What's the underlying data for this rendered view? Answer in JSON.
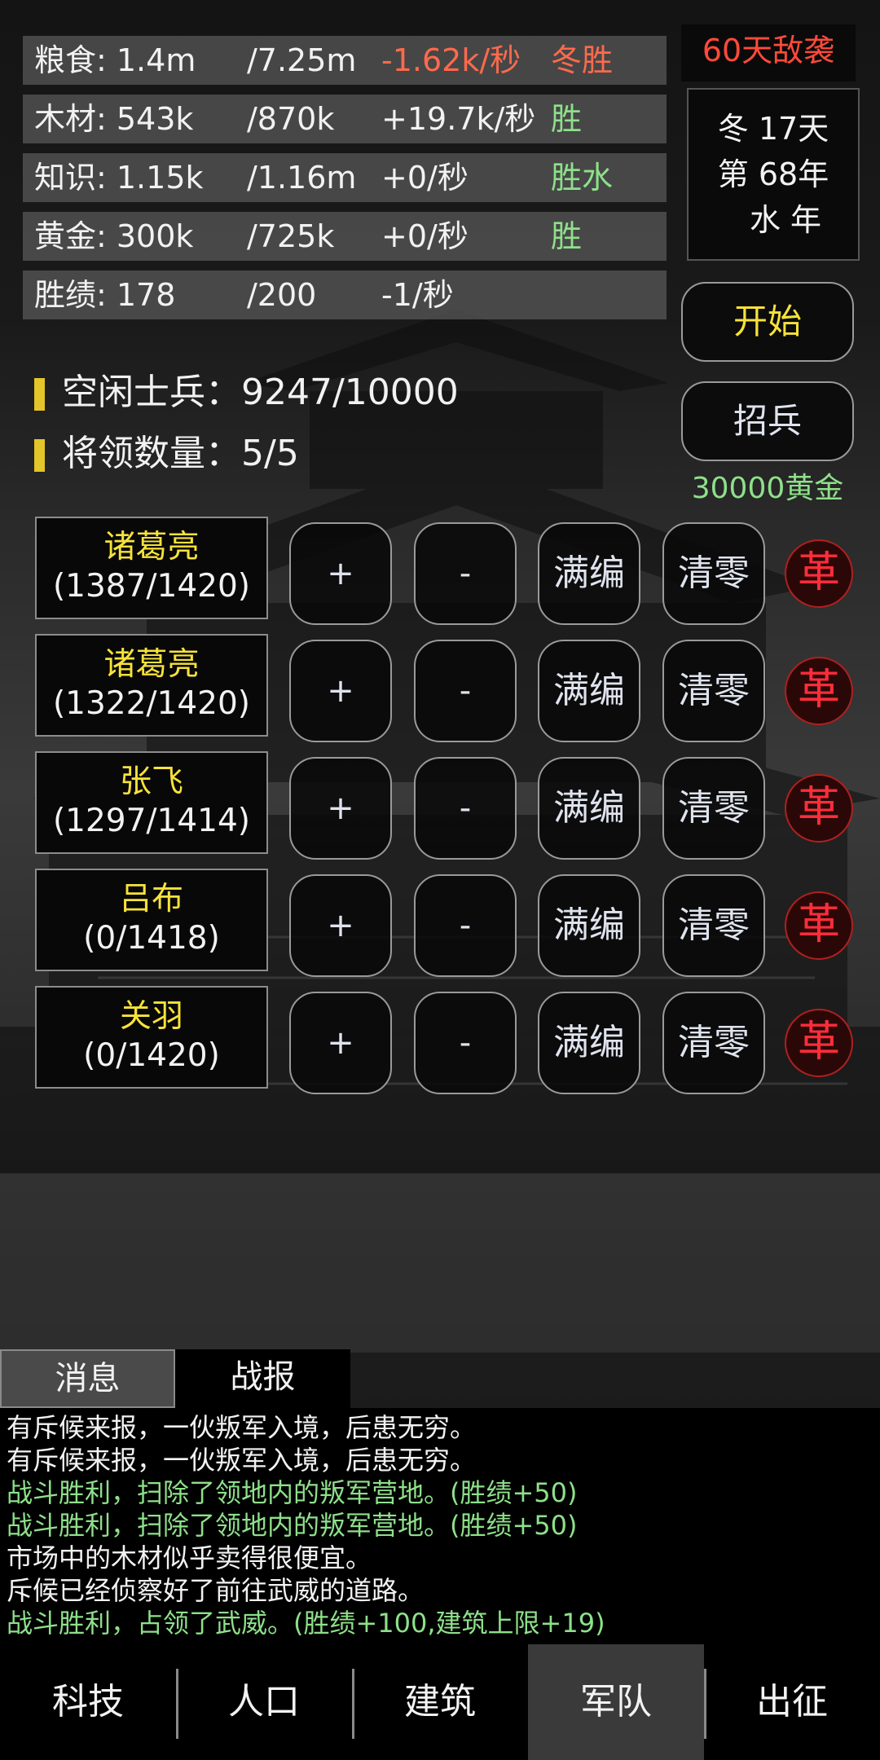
{
  "resources": [
    {
      "name": "粮食: 1.4m",
      "max": "/7.25m",
      "rate": "-1.62k/秒",
      "tag": "冬胜",
      "warn": true
    },
    {
      "name": "木材: 543k",
      "max": "/870k",
      "rate": "+19.7k/秒",
      "tag": "胜",
      "warn": false
    },
    {
      "name": "知识: 1.15k",
      "max": "/1.16m",
      "rate": "+0/秒",
      "tag": "胜水",
      "warn": false
    },
    {
      "name": "黄金: 300k",
      "max": "/725k",
      "rate": "+0/秒",
      "tag": "胜",
      "warn": false
    },
    {
      "name": "胜绩: 178",
      "max": "/200",
      "rate": "-1/秒",
      "tag": "",
      "warn": false
    }
  ],
  "alert": "60天敌袭",
  "date": {
    "line1": "冬 17天",
    "line2": "第 68年",
    "line3": "水 年"
  },
  "buttons": {
    "start": "开始",
    "recruit": "招兵",
    "recruit_cost": "30000黄金"
  },
  "stats": {
    "idle_soldiers": "空闲士兵：9247/10000",
    "generals": "将领数量：5/5"
  },
  "generals": [
    {
      "name": "诸葛亮",
      "count": "(1387/1420)"
    },
    {
      "name": "诸葛亮",
      "count": "(1322/1420)"
    },
    {
      "name": "张飞",
      "count": "(1297/1414)"
    },
    {
      "name": "吕布",
      "count": "(0/1418)"
    },
    {
      "name": "关羽",
      "count": "(0/1420)"
    }
  ],
  "row_buttons": {
    "plus": "+",
    "minus": "-",
    "fill": "满编",
    "clear": "清零",
    "dismiss": "革"
  },
  "tabs": {
    "messages": "消息",
    "battle_report": "战报"
  },
  "log": [
    {
      "text": "有斥候来报，一伙叛军入境，后患无穷。",
      "color": "white"
    },
    {
      "text": "有斥候来报，一伙叛军入境，后患无穷。",
      "color": "white"
    },
    {
      "text": "战斗胜利，扫除了领地内的叛军营地。(胜绩+50)",
      "color": "green"
    },
    {
      "text": "战斗胜利，扫除了领地内的叛军营地。(胜绩+50)",
      "color": "green"
    },
    {
      "text": "市场中的木材似乎卖得很便宜。",
      "color": "white"
    },
    {
      "text": "斥候已经侦察好了前往武威的道路。",
      "color": "white"
    },
    {
      "text": "战斗胜利，占领了武威。(胜绩+100,建筑上限+19)",
      "color": "green"
    }
  ],
  "nav": [
    "科技",
    "人口",
    "建筑",
    "军队",
    "出征"
  ],
  "nav_active": "军队",
  "colors": {
    "gold": "#f6e23a",
    "green": "#8ee08a",
    "red": "#ff4a3a",
    "rebel_red": "#ff2d3a"
  }
}
